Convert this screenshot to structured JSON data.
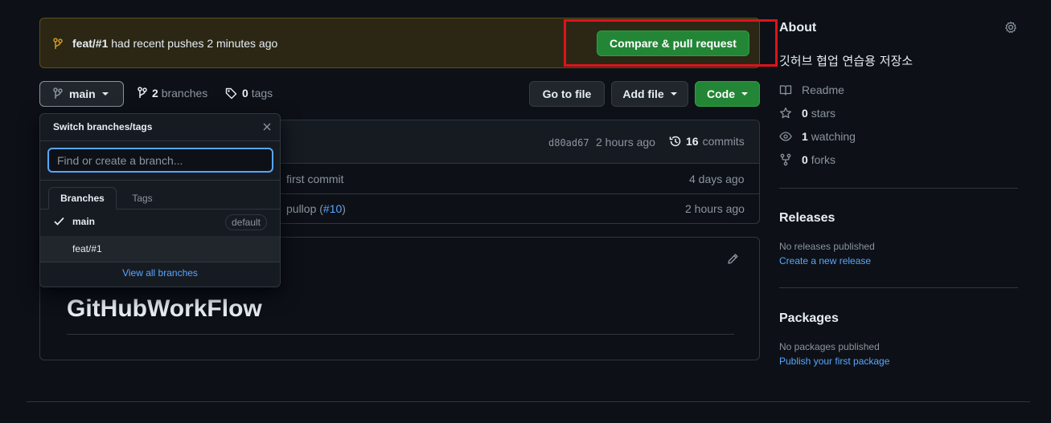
{
  "banner": {
    "branch": "feat/#1",
    "message": " had recent pushes 2 minutes ago",
    "button": "Compare & pull request"
  },
  "toolbar": {
    "branch": "main",
    "branches_count": "2",
    "branches_label": "branches",
    "tags_count": "0",
    "tags_label": "tags",
    "go_to_file": "Go to file",
    "add_file": "Add file",
    "code": "Code"
  },
  "commit_bar": {
    "sha": "d80ad67",
    "time": "2 hours ago",
    "commits_count": "16",
    "commits_label": "commits"
  },
  "files": [
    {
      "message": "first commit",
      "time": "4 days ago"
    },
    {
      "message_prefix": "pullop (",
      "pr": "#10",
      "message_suffix": ")",
      "time": "2 hours ago"
    }
  ],
  "readme": {
    "heading": "GitHubWorkFlow"
  },
  "dropdown": {
    "title": "Switch branches/tags",
    "search_placeholder": "Find or create a branch...",
    "tabs": [
      "Branches",
      "Tags"
    ],
    "items": [
      {
        "name": "main",
        "badge": "default",
        "selected": true
      },
      {
        "name": "feat/#1"
      }
    ],
    "view_all": "View all branches"
  },
  "about": {
    "title": "About",
    "description": "깃허브 협업 연습용 저장소",
    "readme": "Readme",
    "stars_count": "0",
    "stars_label": "stars",
    "watching_count": "1",
    "watching_label": "watching",
    "forks_count": "0",
    "forks_label": "forks"
  },
  "releases": {
    "title": "Releases",
    "empty": "No releases published",
    "link": "Create a new release"
  },
  "packages": {
    "title": "Packages",
    "empty": "No packages published",
    "link": "Publish your first package"
  },
  "colors": {
    "background": "#0d1117",
    "green_button": "#238636",
    "link": "#58a6ff",
    "highlight": "#e0121b"
  }
}
